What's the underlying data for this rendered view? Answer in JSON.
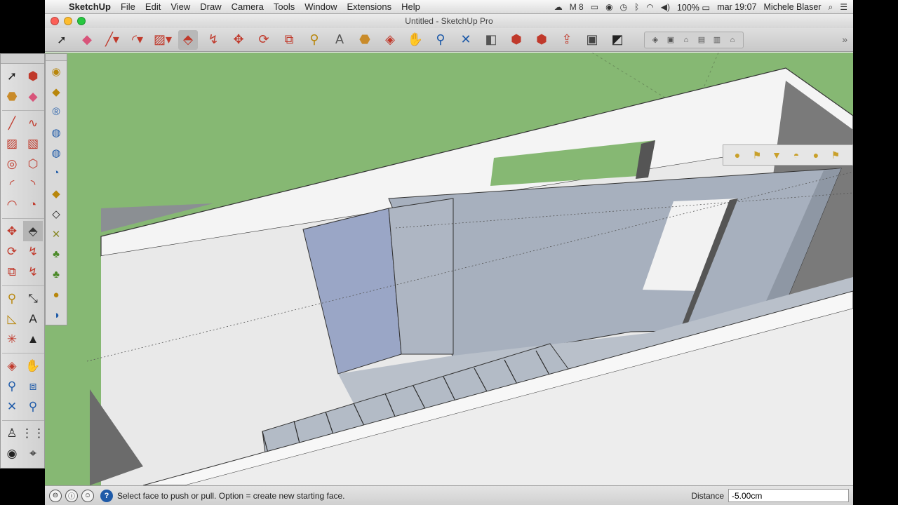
{
  "menubar": {
    "app": "SketchUp",
    "menus": [
      "File",
      "Edit",
      "View",
      "Draw",
      "Camera",
      "Tools",
      "Window",
      "Extensions",
      "Help"
    ],
    "status_items": {
      "drive_count": "8",
      "battery": "100%",
      "clock": "mar 19:07",
      "user": "Michele Blaser"
    }
  },
  "window": {
    "title": "Untitled - SketchUp Pro"
  },
  "toolbar": {
    "icons": [
      "select-icon",
      "eraser-icon",
      "pencil-icon",
      "arc-icon",
      "rectangle-icon",
      "push-pull-icon",
      "offset-icon",
      "move-icon",
      "rotate-icon",
      "scale-icon",
      "tape-measure-icon",
      "text-icon",
      "paint-bucket-icon",
      "orbit-icon",
      "pan-icon",
      "zoom-icon",
      "zoom-extents-icon",
      "section-plane-icon",
      "warehouse-icon",
      "extension-warehouse-icon",
      "share-model-icon",
      "layout-icon",
      "styles-icon"
    ]
  },
  "status": {
    "message": "Select face to push or pull.  Option = create new starting face.",
    "measure_label": "Distance",
    "measure_value": "-5.00cm"
  },
  "colors": {
    "ground": "#86b873",
    "wall_top": "#f4f4f4",
    "wall_face": "#e9e9e9",
    "selected_face": "#9aa6c6",
    "panel_face": "#a7b0be",
    "stairs": "#b3bbc6",
    "dark_wall": "#777777"
  }
}
